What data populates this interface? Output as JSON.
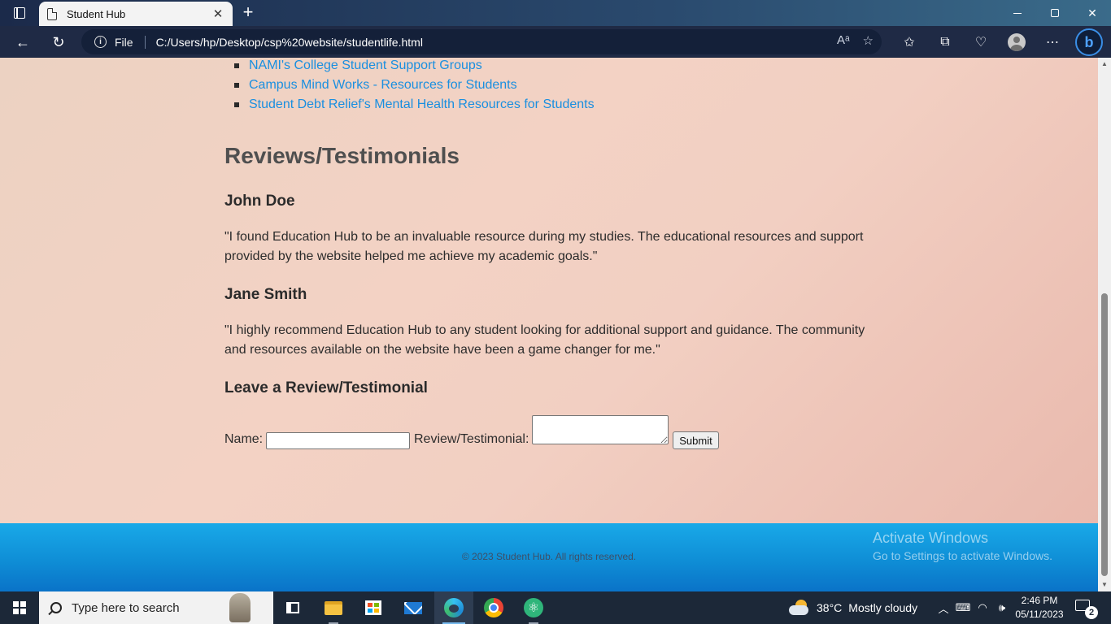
{
  "browser": {
    "tab_title": "Student Hub",
    "tab_close": "✕",
    "new_tab": "+",
    "protocol_label": "File",
    "url": "C:/Users/hp/Desktop/csp%20website/studentlife.html"
  },
  "page": {
    "resource_links": [
      "NAMI's College Student Support Groups",
      "Campus Mind Works - Resources for Students",
      "Student Debt Relief's Mental Health Resources for Students"
    ],
    "reviews_heading": "Reviews/Testimonials",
    "reviews": [
      {
        "author": "John Doe",
        "text": "\"I found Education Hub to be an invaluable resource during my studies. The educational resources and support provided by the website helped me achieve my academic goals.\""
      },
      {
        "author": "Jane Smith",
        "text": "\"I highly recommend Education Hub to any student looking for additional support and guidance. The community and resources available on the website have been a game changer for me.\""
      }
    ],
    "form": {
      "heading": "Leave a Review/Testimonial",
      "name_label": "Name:",
      "name_value": "",
      "review_label": "Review/Testimonial:",
      "review_value": "",
      "submit_label": "Submit"
    },
    "footer_text": "© 2023 Student Hub. All rights reserved."
  },
  "watermark": {
    "line1": "Activate Windows",
    "line2": "Go to Settings to activate Windows."
  },
  "taskbar": {
    "search_placeholder": "Type here to search",
    "weather_temp": "38°C",
    "weather_desc": "Mostly cloudy",
    "time": "2:46 PM",
    "date": "05/11/2023",
    "notification_count": "2"
  },
  "colors": {
    "link": "#1a8fe0",
    "footer_blue": "#0f8ed6",
    "page_bg": "#f2cfc2"
  }
}
